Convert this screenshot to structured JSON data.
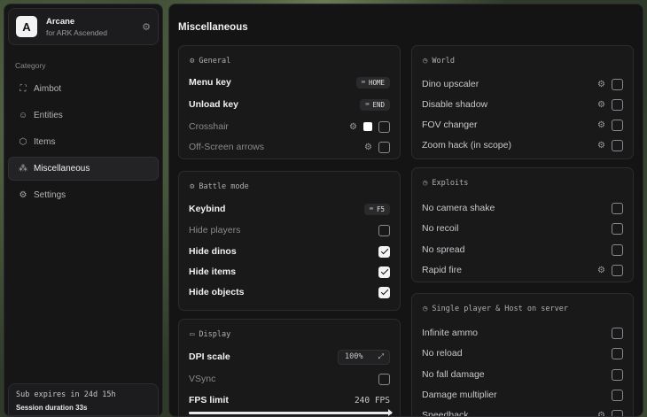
{
  "app": {
    "name": "Arcane",
    "subtitle": "for ARK Ascended"
  },
  "sidebar": {
    "category_label": "Category",
    "items": [
      {
        "label": "Aimbot",
        "icon": "crosshair-icon",
        "active": false
      },
      {
        "label": "Entities",
        "icon": "scan-face-icon",
        "active": false
      },
      {
        "label": "Items",
        "icon": "box-icon",
        "active": false
      },
      {
        "label": "Miscellaneous",
        "icon": "grid-icon",
        "active": true
      },
      {
        "label": "Settings",
        "icon": "gear-icon",
        "active": false
      }
    ],
    "subscription": {
      "expires": "Sub expires in 24d 15h",
      "session": "Session duration 33s"
    }
  },
  "main": {
    "title": "Miscellaneous",
    "general": {
      "title": "General",
      "menu_key": {
        "label": "Menu key",
        "key": "HOME"
      },
      "unload_key": {
        "label": "Unload key",
        "key": "END"
      },
      "crosshair": {
        "label": "Crosshair",
        "checked": false
      },
      "offscreen": {
        "label": "Off-Screen arrows",
        "checked": false
      }
    },
    "battle": {
      "title": "Battle mode",
      "keybind": {
        "label": "Keybind",
        "key": "F5"
      },
      "hide_players": {
        "label": "Hide players",
        "checked": false
      },
      "hide_dinos": {
        "label": "Hide dinos",
        "checked": true
      },
      "hide_items": {
        "label": "Hide items",
        "checked": true
      },
      "hide_objects": {
        "label": "Hide objects",
        "checked": true
      }
    },
    "display": {
      "title": "Display",
      "dpi": {
        "label": "DPI scale",
        "value": "100%"
      },
      "vsync": {
        "label": "VSync",
        "checked": false
      },
      "fps": {
        "label": "FPS limit",
        "value": "240 FPS",
        "fraction": 1.0
      }
    },
    "world": {
      "title": "World",
      "items": [
        {
          "label": "Dino upscaler",
          "checked": false
        },
        {
          "label": "Disable shadow",
          "checked": false
        },
        {
          "label": "FOV changer",
          "checked": false
        },
        {
          "label": "Zoom hack (in scope)",
          "checked": false
        }
      ]
    },
    "exploits": {
      "title": "Exploits",
      "items": [
        {
          "label": "No camera shake",
          "checked": false
        },
        {
          "label": "No recoil",
          "checked": false
        },
        {
          "label": "No spread",
          "checked": false
        },
        {
          "label": "Rapid fire",
          "checked": false
        }
      ]
    },
    "single": {
      "title": "Single player & Host on server",
      "items": [
        {
          "label": "Infinite ammo",
          "checked": false
        },
        {
          "label": "No reload",
          "checked": false
        },
        {
          "label": "No fall damage",
          "checked": false
        },
        {
          "label": "Damage multiplier",
          "checked": false
        },
        {
          "label": "Speedhack",
          "checked": false
        }
      ]
    }
  }
}
